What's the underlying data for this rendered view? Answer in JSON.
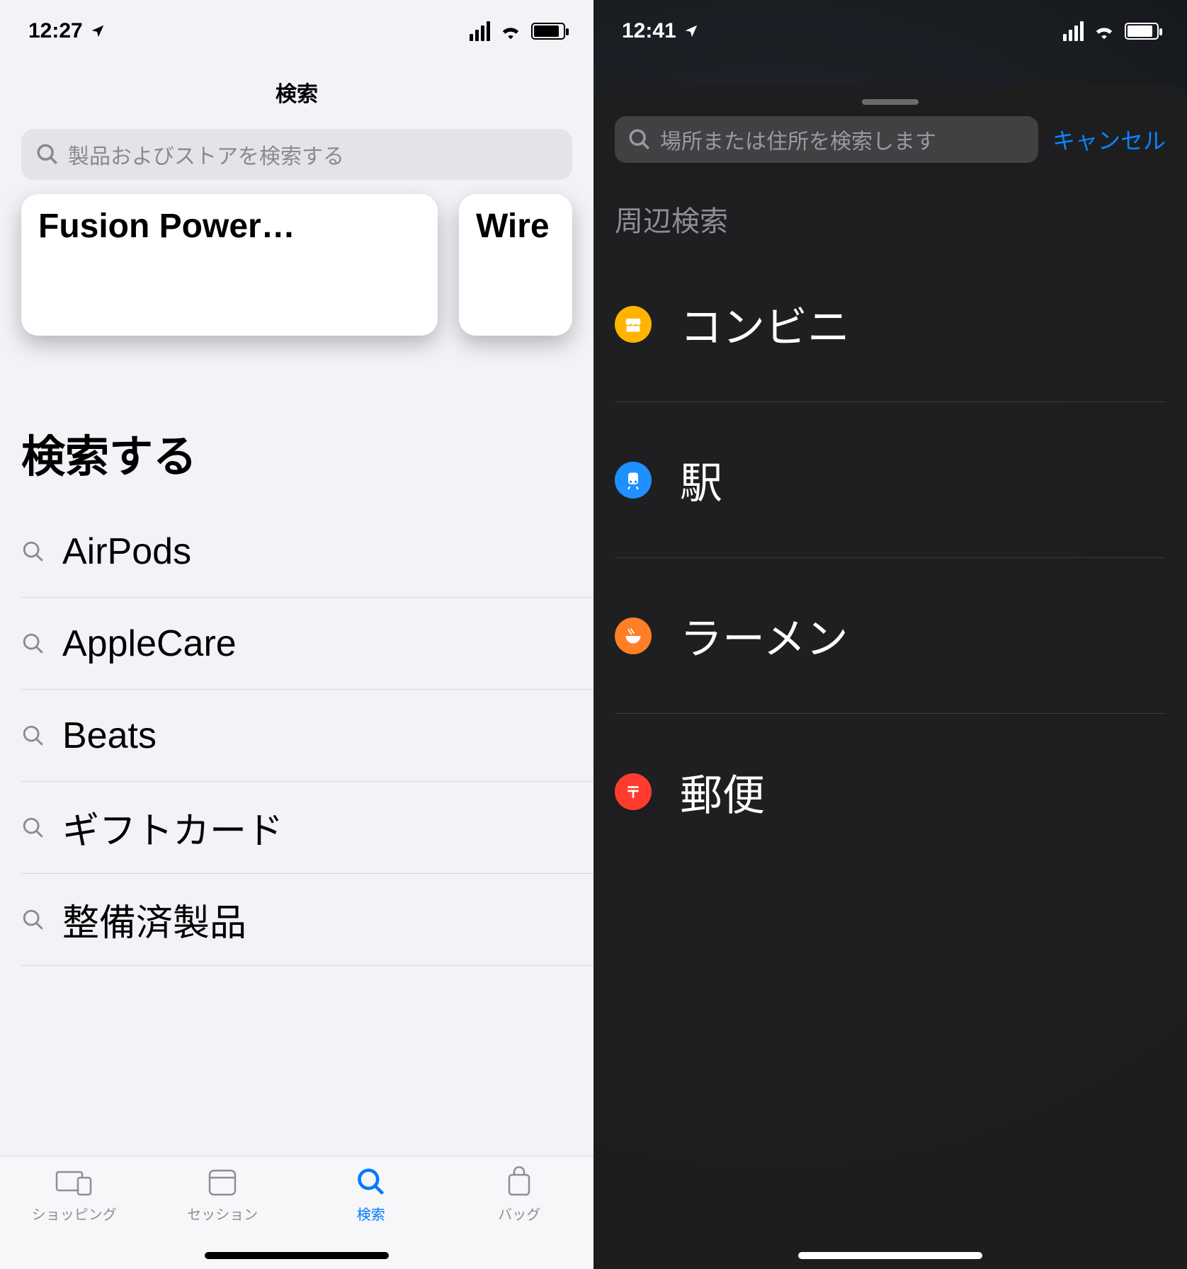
{
  "left": {
    "status_time": "12:27",
    "nav_title": "検索",
    "search_placeholder": "製品およびストアを検索する",
    "cards": [
      {
        "title": "Fusion Power…"
      },
      {
        "title": "Wire"
      }
    ],
    "section_title": "検索する",
    "suggestions": [
      "AirPods",
      "AppleCare",
      "Beats",
      "ギフトカード",
      "整備済製品"
    ],
    "tabs": [
      {
        "label": "ショッピング",
        "icon": "devices",
        "active": false
      },
      {
        "label": "セッション",
        "icon": "calendar",
        "active": false
      },
      {
        "label": "検索",
        "icon": "search",
        "active": true
      },
      {
        "label": "バッグ",
        "icon": "bag",
        "active": false
      }
    ]
  },
  "right": {
    "status_time": "12:41",
    "search_placeholder": "場所または住所を検索します",
    "cancel_label": "キャンセル",
    "section_label": "周辺検索",
    "nearby": [
      {
        "label": "コンビニ",
        "icon": "store",
        "color": "yellow"
      },
      {
        "label": "駅",
        "icon": "train",
        "color": "blue"
      },
      {
        "label": "ラーメン",
        "icon": "bowl",
        "color": "orange"
      },
      {
        "label": "郵便",
        "icon": "post",
        "color": "red"
      }
    ]
  }
}
